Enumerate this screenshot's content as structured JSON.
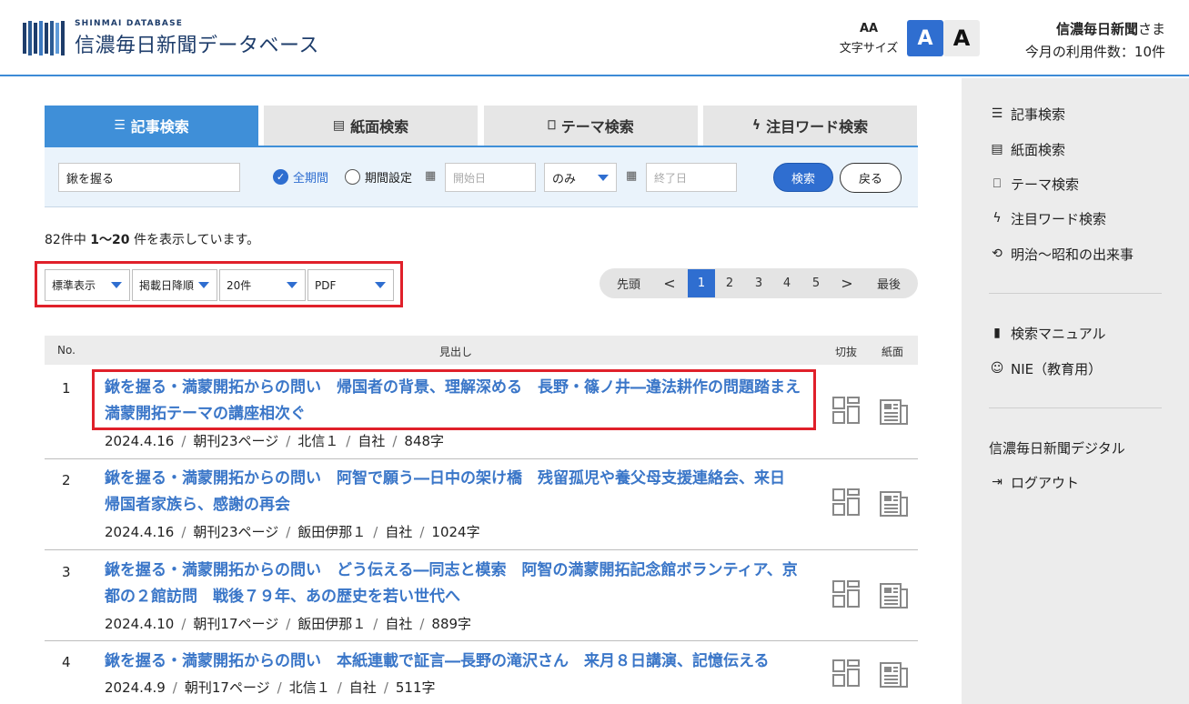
{
  "header": {
    "logo_sub": "SHINMAI DATABASE",
    "logo_main": "信濃毎日新聞データベース",
    "font_size_label": "文字サイズ",
    "font_size_icon": "AA",
    "font_small_label": "A",
    "font_large_label": "A",
    "user_name": "信濃毎日新聞",
    "user_suffix": "さま",
    "usage_text": "今月の利用件数：10件"
  },
  "colors": {
    "accent": "#3f8fd8",
    "primary_button": "#2f6ed0",
    "highlight_border": "#e0202a",
    "link": "#3a76c8"
  },
  "tabs": [
    {
      "label": "記事検索",
      "icon": "list-icon",
      "active": true
    },
    {
      "label": "紙面検索",
      "icon": "newspaper-icon",
      "active": false
    },
    {
      "label": "テーマ検索",
      "icon": "bookmark-icon",
      "active": false
    },
    {
      "label": "注目ワード検索",
      "icon": "lightning-icon",
      "active": false
    }
  ],
  "search": {
    "keyword": "鍬を握る",
    "all_period_label": "全期間",
    "period_setting_label": "期間設定",
    "start_placeholder": "開始日",
    "range_option": "のみ",
    "end_placeholder": "終了日",
    "search_button": "検索",
    "back_button": "戻る"
  },
  "results": {
    "total": "82件中",
    "range": "1〜20",
    "suffix": "件を表示しています。"
  },
  "options": {
    "view": "標準表示",
    "sort": "掲載日降順",
    "per_page": "20件",
    "format": "PDF"
  },
  "pagination": {
    "first": "先頭",
    "prev": "<",
    "pages": [
      "1",
      "2",
      "3",
      "4",
      "5"
    ],
    "current": "1",
    "next": ">",
    "last": "最後"
  },
  "table": {
    "headers": {
      "no": "No.",
      "headline": "見出し",
      "clip": "切抜",
      "paper": "紙面"
    },
    "rows": [
      {
        "no": "1",
        "title": "鍬を握る・満蒙開拓からの問い　帰国者の背景、理解深める　長野・篠ノ井―違法耕作の問題踏まえ　満蒙開拓テーマの講座相次ぐ",
        "date": "2024.4.16",
        "page": "朝刊23ページ",
        "edition": "北信１",
        "source": "自社",
        "chars": "848字"
      },
      {
        "no": "2",
        "title": "鍬を握る・満蒙開拓からの問い　阿智で願う―日中の架け橋　残留孤児や養父母支援連絡会、来日　帰国者家族ら、感謝の再会",
        "date": "2024.4.16",
        "page": "朝刊23ページ",
        "edition": "飯田伊那１",
        "source": "自社",
        "chars": "1024字"
      },
      {
        "no": "3",
        "title": "鍬を握る・満蒙開拓からの問い　どう伝える―同志と模索　阿智の満蒙開拓記念館ボランティア、京都の２館訪問　戦後７９年、あの歴史を若い世代へ",
        "date": "2024.4.10",
        "page": "朝刊17ページ",
        "edition": "飯田伊那１",
        "source": "自社",
        "chars": "889字"
      },
      {
        "no": "4",
        "title": "鍬を握る・満蒙開拓からの問い　本紙連載で証言―長野の滝沢さん　来月８日講演、記憶伝える",
        "date": "2024.4.9",
        "page": "朝刊17ページ",
        "edition": "北信１",
        "source": "自社",
        "chars": "511字"
      }
    ]
  },
  "sidebar": {
    "items": [
      {
        "label": "記事検索",
        "icon": "list-icon"
      },
      {
        "label": "紙面検索",
        "icon": "newspaper-icon"
      },
      {
        "label": "テーマ検索",
        "icon": "bookmark-icon"
      },
      {
        "label": "注目ワード検索",
        "icon": "lightning-icon"
      },
      {
        "label": "明治〜昭和の出来事",
        "icon": "history-icon"
      },
      {
        "label": "検索マニュアル",
        "icon": "book-icon"
      },
      {
        "label": "NIE（教育用）",
        "icon": "face-icon"
      },
      {
        "label": "信濃毎日新聞デジタル",
        "icon": ""
      },
      {
        "label": "ログアウト",
        "icon": "logout-icon"
      }
    ]
  }
}
